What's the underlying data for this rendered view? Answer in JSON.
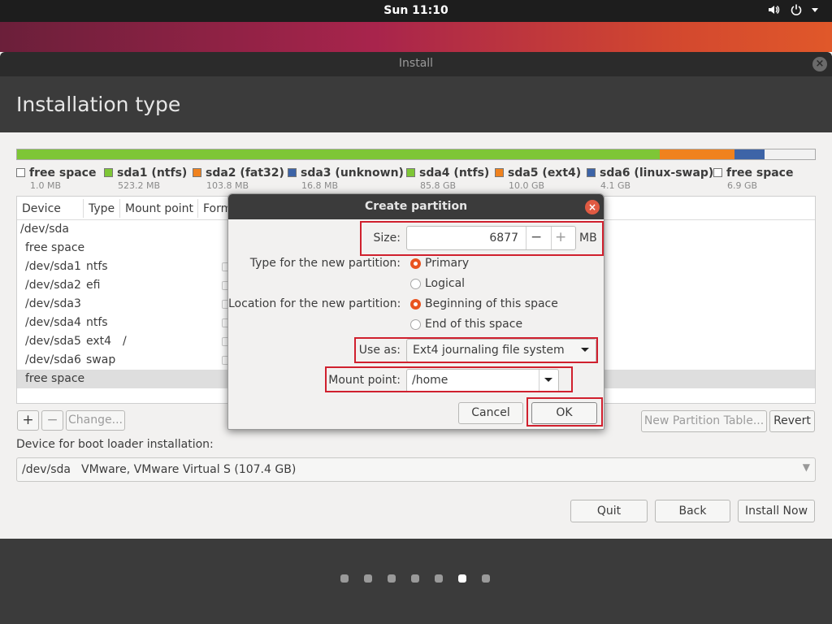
{
  "topbar": {
    "clock": "Sun 11:10",
    "icons": [
      "volume-icon",
      "power-icon",
      "menu-arrow-icon"
    ]
  },
  "window": {
    "title": "Install",
    "page_title": "Installation type"
  },
  "partitions": [
    {
      "name": "free space",
      "size": "1.0 MB",
      "color": "#ffffff"
    },
    {
      "name": "sda1 (ntfs)",
      "size": "523.2 MB",
      "color": "#7ec636"
    },
    {
      "name": "sda2 (fat32)",
      "size": "103.8 MB",
      "color": "#f0821e"
    },
    {
      "name": "sda3 (unknown)",
      "size": "16.8 MB",
      "color": "#3d64a7"
    },
    {
      "name": "sda4 (ntfs)",
      "size": "85.8 GB",
      "color": "#7ec636"
    },
    {
      "name": "sda5 (ext4)",
      "size": "10.0 GB",
      "color": "#f0821e"
    },
    {
      "name": "sda6 (linux-swap)",
      "size": "4.1 GB",
      "color": "#3d64a7"
    },
    {
      "name": "free space",
      "size": "6.9 GB",
      "color": "#ffffff"
    }
  ],
  "table": {
    "headers": {
      "device": "Device",
      "type": "Type",
      "mount": "Mount point",
      "format": "Format?"
    },
    "rows": [
      {
        "device": "/dev/sda",
        "type": "",
        "mount": ""
      },
      {
        "device": "free space",
        "type": "",
        "mount": ""
      },
      {
        "device": "/dev/sda1",
        "type": "ntfs",
        "mount": ""
      },
      {
        "device": "/dev/sda2",
        "type": "efi",
        "mount": ""
      },
      {
        "device": "/dev/sda3",
        "type": "",
        "mount": ""
      },
      {
        "device": "/dev/sda4",
        "type": "ntfs",
        "mount": ""
      },
      {
        "device": "/dev/sda5",
        "type": "ext4",
        "mount": "/"
      },
      {
        "device": "/dev/sda6",
        "type": "swap",
        "mount": ""
      },
      {
        "device": "free space",
        "type": "",
        "mount": ""
      }
    ]
  },
  "toolbar": {
    "add": "+",
    "remove": "−",
    "change": "Change...",
    "new_table": "New Partition Table...",
    "revert": "Revert"
  },
  "boot": {
    "label": "Device for boot loader installation:",
    "device": "/dev/sda",
    "description": "VMware, VMware Virtual S (107.4 GB)"
  },
  "actions": {
    "quit": "Quit",
    "back": "Back",
    "install": "Install Now"
  },
  "progress": {
    "total_steps": 7,
    "current_step": 6
  },
  "dialog": {
    "title": "Create partition",
    "size_label": "Size:",
    "size_value": "6877",
    "size_unit": "MB",
    "minus": "−",
    "plus": "+",
    "type_label": "Type for the new partition:",
    "type_primary": "Primary",
    "type_logical": "Logical",
    "type_selected": "Primary",
    "location_label": "Location for the new partition:",
    "location_beginning": "Beginning of this space",
    "location_end": "End of this space",
    "location_selected": "Beginning of this space",
    "use_as_label": "Use as:",
    "use_as_value": "Ext4 journaling file system",
    "mount_label": "Mount point:",
    "mount_value": "/home",
    "cancel": "Cancel",
    "ok": "OK"
  },
  "colors": {
    "accent": "#e95420",
    "highlight": "#d0202e"
  }
}
